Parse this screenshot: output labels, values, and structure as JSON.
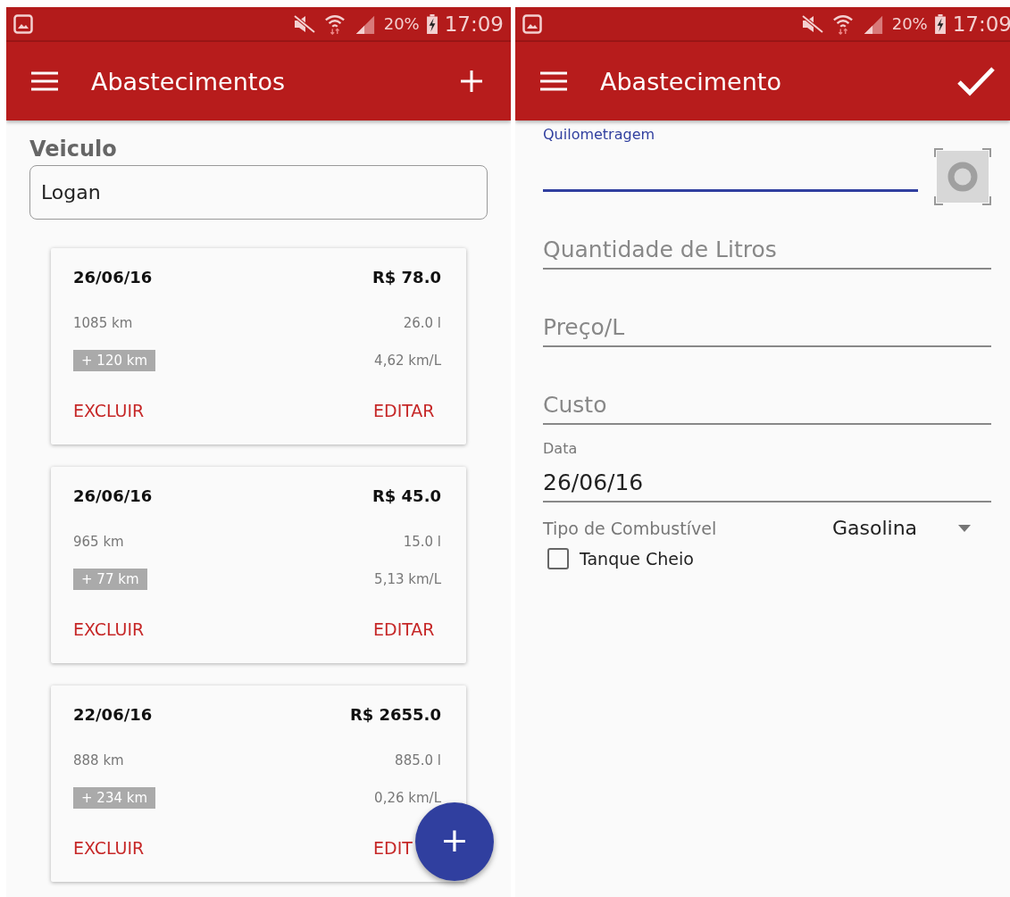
{
  "list_screen": {
    "status_bar": {
      "battery": "20%",
      "time": "17:09"
    },
    "title": "Abastecimentos",
    "vehicle_label": "Veiculo",
    "vehicle_value": "Logan",
    "entries": [
      {
        "date": "26/06/16",
        "price": "R$ 78.0",
        "odometer": "1085 km",
        "liters": "26.0 l",
        "distance": "+ 120 km",
        "efficiency": "4,62 km/L",
        "delete": "EXCLUIR",
        "edit": "EDITAR"
      },
      {
        "date": "26/06/16",
        "price": "R$ 45.0",
        "odometer": "965 km",
        "liters": "15.0 l",
        "distance": "+ 77 km",
        "efficiency": "5,13 km/L",
        "delete": "EXCLUIR",
        "edit": "EDITAR"
      },
      {
        "date": "22/06/16",
        "price": "R$ 2655.0",
        "odometer": "888 km",
        "liters": "885.0 l",
        "distance": "+ 234 km",
        "efficiency": "0,26 km/L",
        "delete": "EXCLUIR",
        "edit": "EDIT"
      }
    ],
    "fab": "+"
  },
  "form_screen": {
    "status_bar": {
      "battery": "20%",
      "time": "17:09"
    },
    "title": "Abastecimento",
    "fields": [
      {
        "label": "Quilometragem",
        "focused": true
      },
      {
        "placeholder": "Quantidade de Litros",
        "focused": false
      },
      {
        "placeholder": "Preço/L",
        "focused": false
      },
      {
        "placeholder": "Custo",
        "focused": false
      },
      {
        "label": "Data",
        "value": "26/06/16",
        "focused": false
      }
    ],
    "fuel_label": "Tipo de Combustível",
    "fuel_value": "Gasolina",
    "full_tank": {
      "label": "Tanque Cheio",
      "checked": false
    }
  }
}
